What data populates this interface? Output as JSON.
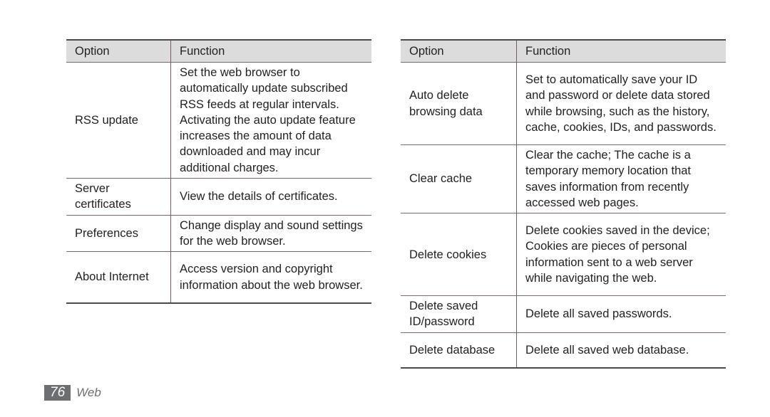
{
  "left_table": {
    "headers": {
      "option": "Option",
      "function": "Function"
    },
    "rows": [
      {
        "option": "RSS update",
        "function": "Set the web browser to automatically update subscribed RSS feeds at regular intervals. Activating the auto update feature increases the amount of data downloaded and may incur additional charges."
      },
      {
        "option": "Server certificates",
        "function": "View the details of certificates."
      },
      {
        "option": "Preferences",
        "function": "Change display and sound settings for the web browser."
      },
      {
        "option": "About Internet",
        "function": "Access version and copyright information about the web browser."
      }
    ]
  },
  "right_table": {
    "headers": {
      "option": "Option",
      "function": "Function"
    },
    "rows": [
      {
        "option": "Auto delete browsing data",
        "function": "Set to automatically save your ID and password or delete data stored while browsing, such as the history, cache, cookies, IDs, and passwords."
      },
      {
        "option": "Clear cache",
        "function": "Clear the cache; The cache is a temporary memory location that saves information from recently accessed web pages."
      },
      {
        "option": "Delete cookies",
        "function": "Delete cookies saved in the device; Cookies are pieces of personal information sent to a web server while navigating the web."
      },
      {
        "option": "Delete saved ID/password",
        "function": "Delete all saved passwords."
      },
      {
        "option": "Delete database",
        "function": "Delete all saved web database."
      }
    ]
  },
  "footer": {
    "page_number": "76",
    "section": "Web"
  }
}
